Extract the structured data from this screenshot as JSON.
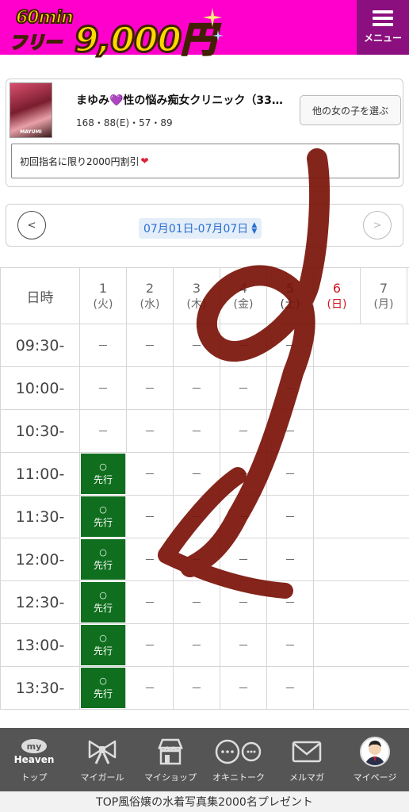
{
  "header": {
    "banner_top": "60min",
    "banner_bottom": "フリー",
    "banner_price": "9,000円",
    "menu_label": "メニュー",
    "bg_color": "#ff00cc",
    "menu_bg_color": "#8b0f7e"
  },
  "profile": {
    "name": "まゆみ💜性の悩み痴女クリニック（33…",
    "stats": "168・88(E)・57・89",
    "thumb_caption": "MAYUMI",
    "other_girl_button": "他の女の子を選ぶ",
    "promo_text": "初回指名に限り2000円割引",
    "promo_icon": "heart-icon"
  },
  "week_nav": {
    "prev": "<",
    "next": ">",
    "range": "07月01日-07月07日"
  },
  "schedule": {
    "header_label": "日時",
    "days": [
      {
        "num": "1",
        "wk": "(火)"
      },
      {
        "num": "2",
        "wk": "(水)"
      },
      {
        "num": "3",
        "wk": "(木)"
      },
      {
        "num": "4",
        "wk": "(金)"
      },
      {
        "num": "5",
        "wk": "(土)"
      },
      {
        "num": "6",
        "wk": "(日)"
      },
      {
        "num": "7",
        "wk": "(月)"
      }
    ],
    "rows": [
      {
        "time": "09:30-",
        "slots": [
          "－",
          "－",
          "－",
          "－",
          "－",
          "",
          ""
        ]
      },
      {
        "time": "10:00-",
        "slots": [
          "－",
          "－",
          "－",
          "－",
          "－",
          "",
          ""
        ]
      },
      {
        "time": "10:30-",
        "slots": [
          "－",
          "－",
          "－",
          "－",
          "－",
          "",
          ""
        ]
      },
      {
        "time": "11:00-",
        "slots": [
          "○先行",
          "－",
          "－",
          "－",
          "－",
          "",
          ""
        ]
      },
      {
        "time": "11:30-",
        "slots": [
          "○先行",
          "－",
          "－",
          "－",
          "－",
          "",
          ""
        ]
      },
      {
        "time": "12:00-",
        "slots": [
          "○先行",
          "－",
          "－",
          "－",
          "－",
          "",
          ""
        ]
      },
      {
        "time": "12:30-",
        "slots": [
          "○先行",
          "－",
          "－",
          "－",
          "－",
          "",
          ""
        ]
      },
      {
        "time": "13:00-",
        "slots": [
          "○先行",
          "－",
          "－",
          "－",
          "－",
          "",
          ""
        ]
      },
      {
        "time": "13:30-",
        "slots": [
          "○先行",
          "－",
          "－",
          "－",
          "－",
          "",
          ""
        ]
      }
    ],
    "avail_circle": "○",
    "avail_label": "先行",
    "empty_mark": "－",
    "available_color": "#0f6f1e",
    "sunday_color": "#d0141e"
  },
  "bottom_nav": {
    "items": [
      {
        "label": "トップ",
        "icon": "my-heaven-icon"
      },
      {
        "label": "マイガール",
        "icon": "ribbon-icon"
      },
      {
        "label": "マイショップ",
        "icon": "shop-icon"
      },
      {
        "label": "オキニトーク",
        "icon": "chat-icon"
      },
      {
        "label": "メルマガ",
        "icon": "mail-icon"
      },
      {
        "label": "マイページ",
        "icon": "avatar-icon"
      }
    ],
    "logo_top": "my",
    "logo_bottom": "Heaven"
  },
  "ticker": {
    "text": "TOP風俗嬢の水着写真集2000名プレゼント"
  },
  "annotation": {
    "stroke_color": "#7a1208"
  }
}
